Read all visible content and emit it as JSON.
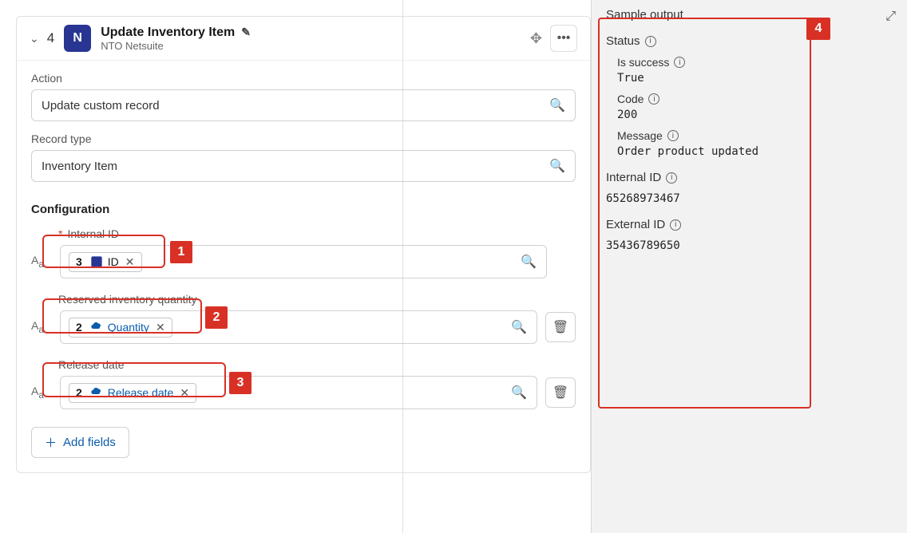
{
  "header": {
    "step_number": "4",
    "title": "Update Inventory Item",
    "subtitle": "NTO Netsuite"
  },
  "form": {
    "action_label": "Action",
    "action_value": "Update custom record",
    "record_type_label": "Record type",
    "record_type_value": "Inventory Item",
    "configuration_label": "Configuration",
    "fields": {
      "internal_id": {
        "label": "Internal ID",
        "pill_step": "3",
        "pill_text": "ID"
      },
      "reserved_qty": {
        "label": "Reserved inventory quantity",
        "pill_step": "2",
        "pill_text": "Quantity"
      },
      "release_date": {
        "label": "Release date",
        "pill_step": "2",
        "pill_text": "Release date"
      }
    },
    "add_fields_label": "Add fields"
  },
  "output": {
    "title": "Sample output",
    "status_label": "Status",
    "is_success_label": "Is success",
    "is_success_value": "True",
    "code_label": "Code",
    "code_value": "200",
    "message_label": "Message",
    "message_value": "Order product updated",
    "internal_id_label": "Internal ID",
    "internal_id_value": "65268973467",
    "external_id_label": "External ID",
    "external_id_value": "35436789650"
  },
  "callouts": {
    "c1": "1",
    "c2": "2",
    "c3": "3",
    "c4": "4"
  }
}
